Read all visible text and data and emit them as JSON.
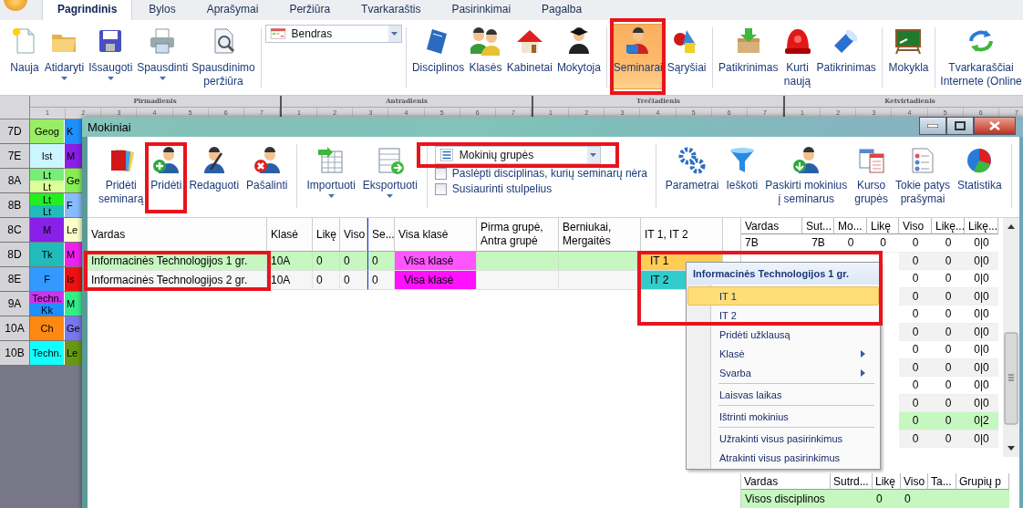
{
  "app_tabs": [
    {
      "label": "Pagrindinis",
      "selected": true
    },
    {
      "label": "Bylos",
      "selected": false
    },
    {
      "label": "Aprašymai",
      "selected": false
    },
    {
      "label": "Peržiūra",
      "selected": false
    },
    {
      "label": "Tvarkaraštis",
      "selected": false
    },
    {
      "label": "Pasirinkimai",
      "selected": false
    },
    {
      "label": "Pagalba",
      "selected": false
    }
  ],
  "ribbon": [
    {
      "kind": "button",
      "label": "Nauja",
      "selected": false
    },
    {
      "kind": "button",
      "label": "Atidaryti",
      "has_menu": true,
      "selected": false
    },
    {
      "kind": "button",
      "label": "Išsaugoti",
      "has_menu": true,
      "selected": false
    },
    {
      "kind": "button",
      "label": "Spausdinti",
      "has_menu": true,
      "selected": false
    },
    {
      "kind": "button",
      "label": "Spausdinimo\nperžiūra",
      "selected": false
    },
    {
      "kind": "select",
      "value": "Bendras"
    },
    {
      "kind": "button",
      "label": "Disciplinos",
      "selected": false
    },
    {
      "kind": "button",
      "label": "Klasės",
      "selected": false
    },
    {
      "kind": "button",
      "label": "Kabinetai",
      "selected": false
    },
    {
      "kind": "button",
      "label": "Mokytoja",
      "selected": false
    },
    {
      "kind": "button",
      "label": "Seminarai",
      "selected": true,
      "framed": true
    },
    {
      "kind": "button",
      "label": "Sąryšiai",
      "selected": false
    },
    {
      "kind": "button",
      "label": "Patikrinimas",
      "selected": false
    },
    {
      "kind": "button",
      "label": "Kurti\nnaują",
      "selected": false
    },
    {
      "kind": "button",
      "label": "Patikrinimas",
      "selected": false
    },
    {
      "kind": "button",
      "label": "Mokykla",
      "selected": false
    },
    {
      "kind": "button",
      "label": "Tvarkaraščiai\nInternete (Online",
      "selected": false
    }
  ],
  "timetable": {
    "days": [
      {
        "name": "Pirmadienis",
        "periods": [
          "1",
          "2",
          "3",
          "4",
          "5",
          "6",
          "7"
        ]
      },
      {
        "name": "Antradienis",
        "periods": [
          "1",
          "2",
          "3",
          "4",
          "5",
          "6",
          "7"
        ]
      },
      {
        "name": "Trečiadienis",
        "periods": [
          "1",
          "2",
          "3",
          "4",
          "5",
          "6",
          "7"
        ]
      },
      {
        "name": "Ketvirtadienis",
        "periods": [
          "1",
          "2",
          "3",
          "4",
          "5",
          "6",
          "7"
        ]
      }
    ],
    "classes": [
      {
        "name": "7D",
        "lessons": [
          [
            {
              "text": "Geog",
              "color": "#99ee66"
            }
          ],
          [
            {
              "text": "K",
              "color": "#1e8fff"
            }
          ]
        ]
      },
      {
        "name": "7E",
        "lessons": [
          [
            {
              "text": "Ist",
              "color": "#ccf6ff"
            }
          ],
          [
            {
              "text": "M",
              "color": "#8a1fe8"
            }
          ]
        ]
      },
      {
        "name": "8A",
        "lessons": [
          [
            {
              "text": "Lt",
              "color": "#77ee77"
            },
            {
              "text": "Lt",
              "color": "#ddff99"
            }
          ],
          [
            {
              "text": "Ge",
              "color": "#88ee55"
            }
          ]
        ]
      },
      {
        "name": "8B",
        "lessons": [
          [
            {
              "text": "Lt",
              "color": "#22ee22"
            },
            {
              "text": "Lt",
              "color": "#22bbbb"
            }
          ],
          [
            {
              "text": "F",
              "color": "#88bbff"
            }
          ]
        ]
      },
      {
        "name": "8C",
        "lessons": [
          [
            {
              "text": "M",
              "color": "#8a1fe8"
            }
          ],
          [
            {
              "text": "Le",
              "color": "#ffffcc"
            }
          ]
        ]
      },
      {
        "name": "8D",
        "lessons": [
          [
            {
              "text": "Tk",
              "color": "#22bbbb"
            }
          ],
          [
            {
              "text": "M",
              "color": "#ee22ee"
            }
          ]
        ]
      },
      {
        "name": "8E",
        "lessons": [
          [
            {
              "text": "F",
              "color": "#3399ff"
            }
          ],
          [
            {
              "text": "Is",
              "color": "#ee1111"
            }
          ]
        ]
      },
      {
        "name": "9A",
        "lessons": [
          [
            {
              "text": "Techn.",
              "color": "#cc33ee"
            },
            {
              "text": "Kk",
              "color": "#1e8fff"
            }
          ],
          [
            {
              "text": "M",
              "color": "#33ee88"
            }
          ]
        ]
      },
      {
        "name": "10A",
        "lessons": [
          [
            {
              "text": "Ch",
              "color": "#ff8811"
            }
          ],
          [
            {
              "text": "Ge",
              "color": "#7777ee"
            }
          ]
        ]
      },
      {
        "name": "10B",
        "lessons": [
          [
            {
              "text": "Techn.",
              "color": "#11ffff"
            }
          ],
          [
            {
              "text": "Le",
              "color": "#669911"
            }
          ]
        ]
      }
    ]
  },
  "dialog": {
    "title": "Mokiniai",
    "toolbar": [
      {
        "kind": "button",
        "label": "Pridėti\nseminarą"
      },
      {
        "kind": "button",
        "label": "Pridėti",
        "framed": true
      },
      {
        "kind": "button",
        "label": "Redaguoti"
      },
      {
        "kind": "button",
        "label": "Pašalinti"
      },
      {
        "kind": "button",
        "label": "Importuoti",
        "has_menu": true
      },
      {
        "kind": "button",
        "label": "Eksportuoti",
        "has_menu": true
      },
      {
        "kind": "options",
        "select": {
          "value": "Mokinių grupės",
          "framed": true
        },
        "checkboxes": [
          {
            "label": "Paslėpti disciplinas, kurių seminarų nėra",
            "checked": false
          },
          {
            "label": "Susiaurinti stulpelius",
            "checked": false
          }
        ]
      },
      {
        "kind": "button",
        "label": "Parametrai"
      },
      {
        "kind": "button",
        "label": "Ieškoti"
      },
      {
        "kind": "button",
        "label": "Paskirti mokinius\nį seminarus"
      },
      {
        "kind": "button",
        "label": "Kurso\ngrupės"
      },
      {
        "kind": "button",
        "label": "Tokie patys\nprašymai"
      },
      {
        "kind": "button",
        "label": "Statistika"
      }
    ],
    "seminars_table": {
      "columns": [
        {
          "label": "Vardas",
          "framed": true
        },
        {
          "label": "Klasė"
        },
        {
          "label": "Likę"
        },
        {
          "label": "Viso"
        },
        {
          "label": "Se..."
        },
        {
          "label": "Visa klasė"
        },
        {
          "label": "Pirma grupė,\nAntra grupė"
        },
        {
          "label": "Berniukai,\nMergaitės"
        },
        {
          "label": "IT 1, IT 2",
          "framed": true
        }
      ],
      "rows": [
        {
          "selected": true,
          "cells": [
            "Informacinės Technologijos 1 gr.",
            "10A",
            "0",
            "0",
            "0",
            {
              "text": "Visa klasė",
              "color": "#ff55ff"
            },
            null,
            null,
            {
              "text": "IT 1",
              "color": "#ffcc55"
            }
          ]
        },
        {
          "selected": false,
          "cells": [
            "Informacinės Technologijos 2 gr.",
            "10A",
            "0",
            "0",
            "0",
            {
              "text": "Visa klasė",
              "color": "#ff11ff"
            },
            null,
            null,
            {
              "text": "IT 2",
              "color": "#33cccc"
            }
          ]
        }
      ]
    },
    "classes_table": {
      "columns": [
        "Vardas",
        "Sut...",
        "Mo...",
        "Likę",
        "Viso",
        "Likę...",
        "Likę..."
      ],
      "rows": [
        {
          "highlighted": false,
          "values": [
            "7B",
            "7B",
            "0",
            "0",
            "0",
            "0",
            "0|0"
          ]
        },
        {
          "highlighted": false,
          "values": [
            "0",
            "0",
            "0|0"
          ]
        },
        {
          "highlighted": false,
          "values": [
            "0",
            "0",
            "0|0"
          ]
        },
        {
          "highlighted": false,
          "values": [
            "0",
            "0",
            "0|0"
          ]
        },
        {
          "highlighted": false,
          "values": [
            "0",
            "0",
            "0|0"
          ]
        },
        {
          "highlighted": false,
          "values": [
            "0",
            "0",
            "0|0"
          ]
        },
        {
          "highlighted": false,
          "values": [
            "0",
            "0",
            "0|0"
          ]
        },
        {
          "highlighted": false,
          "values": [
            "0",
            "0",
            "0|0"
          ]
        },
        {
          "highlighted": false,
          "values": [
            "0",
            "0",
            "0|0"
          ]
        },
        {
          "highlighted": false,
          "values": [
            "0",
            "0",
            "0|0"
          ]
        },
        {
          "highlighted": true,
          "values": [
            "0",
            "0",
            "0|2"
          ]
        },
        {
          "highlighted": false,
          "values": [
            "0",
            "0",
            "0|0"
          ]
        }
      ]
    },
    "totals_table": {
      "columns": [
        "Vardas",
        "Sutrd...",
        "Likę",
        "Viso",
        "Ta...",
        "Grupių p"
      ],
      "rows": [
        {
          "cells": [
            "Visos disciplinos",
            null,
            "0",
            "0",
            null,
            null
          ]
        }
      ]
    }
  },
  "context_menu": {
    "title": "Informacinės Technologijos 1 gr.",
    "items": [
      {
        "label": "IT 1",
        "selected": true,
        "framed": true
      },
      {
        "label": "IT 2",
        "selected": false,
        "framed": true
      },
      {
        "label": "Pridėti užklausą",
        "selected": false
      },
      {
        "label": "Klasė",
        "selected": false,
        "submenu": true
      },
      {
        "label": "Svarba",
        "selected": false,
        "submenu": true
      },
      {
        "label": "Laisvas laikas",
        "selected": false,
        "separator_before": true
      },
      {
        "label": "Ištrinti mokinius",
        "selected": false,
        "separator_before": true
      },
      {
        "label": "Užrakinti visus pasirinkimus",
        "selected": false,
        "separator_before": true
      },
      {
        "label": "Atrakinti visus pasirinkimus",
        "selected": false
      }
    ]
  }
}
